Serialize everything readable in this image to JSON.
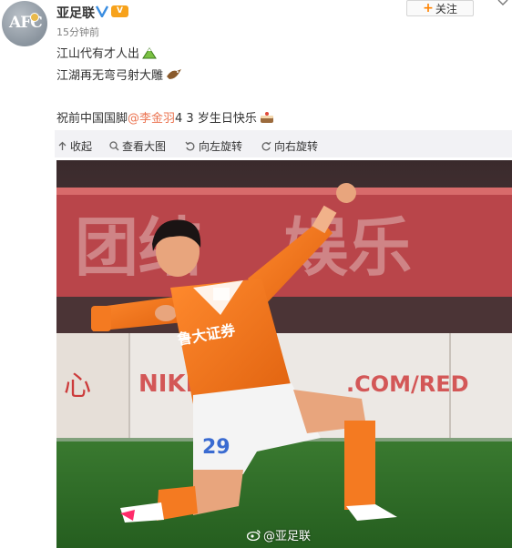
{
  "post": {
    "author": "亚足联",
    "avatar_text": "AFC",
    "vip_badge": "V",
    "time": "15分钟前",
    "follow_label": "关注",
    "line1": "江山代有才人出",
    "line2": "江湖再无弯弓射大雕",
    "line3_prefix": "祝前中国国脚",
    "line3_mention": "@李金羽",
    "line3_suffix": " 4 3 岁生日快乐"
  },
  "toolbar": {
    "collapse": "收起",
    "view_large": "查看大图",
    "rotate_left": "向左旋转",
    "rotate_right": "向右旋转"
  },
  "photo": {
    "banner_text_left": "团结",
    "banner_text_right": "娱乐",
    "ad_left": "心",
    "ad_text": "NIKE",
    "ad_url": ".COM/RED",
    "jersey_sponsor": "鲁大证券",
    "jersey_number": "29",
    "watermark": "@亚足联"
  },
  "colors": {
    "accent": "#ff8200",
    "mention": "#eb7350",
    "toolbar_bg": "#f2f2f5",
    "jersey": "#f47a21",
    "pitch": "#2e6f27"
  }
}
